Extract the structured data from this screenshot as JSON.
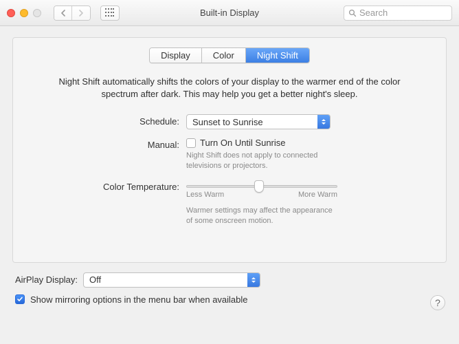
{
  "window": {
    "title": "Built-in Display",
    "search_placeholder": "Search"
  },
  "tabs": {
    "display": "Display",
    "color": "Color",
    "night_shift": "Night Shift",
    "active": "night_shift"
  },
  "description": "Night Shift automatically shifts the colors of your display to the warmer end of the color spectrum after dark. This may help you get a better night's sleep.",
  "schedule": {
    "label": "Schedule:",
    "value": "Sunset to Sunrise"
  },
  "manual": {
    "label": "Manual:",
    "checkbox_label": "Turn On Until Sunrise",
    "checked": false,
    "hint": "Night Shift does not apply to connected televisions or projectors."
  },
  "color_temp": {
    "label": "Color Temperature:",
    "less": "Less Warm",
    "more": "More Warm",
    "hint": "Warmer settings may affect the appearance of some onscreen motion."
  },
  "airplay": {
    "label": "AirPlay Display:",
    "value": "Off"
  },
  "mirroring": {
    "checked": true,
    "label": "Show mirroring options in the menu bar when available"
  },
  "help_label": "?"
}
